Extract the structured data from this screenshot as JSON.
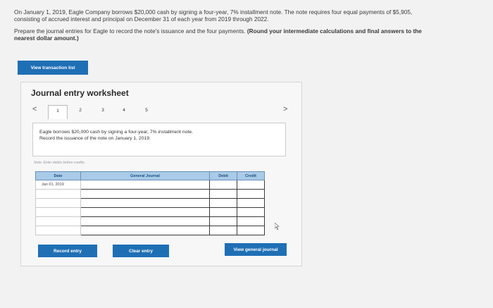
{
  "problem": {
    "paragraph1": "On January 1, 2019, Eagle Company borrows $20,000 cash by signing a four-year, 7% installment note. The note requires four equal payments of $5,905, consisting of accrued interest and principal on December 31 of each year from 2019 through 2022.",
    "paragraph2_text": "Prepare the journal entries for Eagle to record the note's issuance and the four payments. ",
    "paragraph2_bold": "(Round your intermediate calculations and final answers to the nearest dollar amount.)"
  },
  "buttons": {
    "view_transaction_list": "View transaction list",
    "record_entry": "Record entry",
    "clear_entry": "Clear entry",
    "view_general_journal": "View general journal"
  },
  "worksheet": {
    "title": "Journal entry worksheet",
    "prev_arrow": "<",
    "next_arrow": ">",
    "pages": [
      "1",
      "2",
      "3",
      "4",
      "5"
    ],
    "active_page": "1",
    "description_line1": "Eagle borrows $20,000 cash by signing a four-year, 7% installment note.",
    "description_line2": "Record the issuance of the note on January 1, 2019.",
    "note": "Note: Enter debits before credits."
  },
  "table": {
    "headers": {
      "date": "Date",
      "general_journal": "General Journal",
      "debit": "Debit",
      "credit": "Credit"
    },
    "date_value": "Jan 01, 2019",
    "row_count": 6
  },
  "colors": {
    "accent": "#1f6fb5",
    "header_bg": "#a9cbe8"
  }
}
